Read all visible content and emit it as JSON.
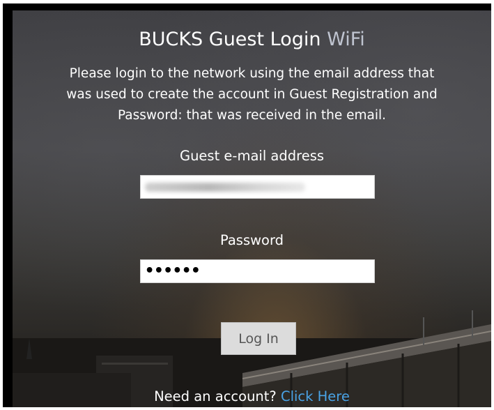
{
  "header": {
    "title_main": "BUCKS Guest Login",
    "title_accent": "WiFi"
  },
  "instructions": {
    "line1": "Please login to the network using the email address that",
    "line2": "was used to create the account in Guest Registration and",
    "line3": "Password: that was received in the email."
  },
  "email": {
    "label": "Guest e-mail address",
    "value": ""
  },
  "password": {
    "label": "Password",
    "value": "••••••"
  },
  "login": {
    "button_label": "Log In"
  },
  "footer": {
    "prompt": "Need an account?",
    "link_label": "Click Here"
  },
  "colors": {
    "accent_text": "#bfc4d0",
    "link": "#4aa3e6",
    "button_bg": "#dcdcdc"
  }
}
